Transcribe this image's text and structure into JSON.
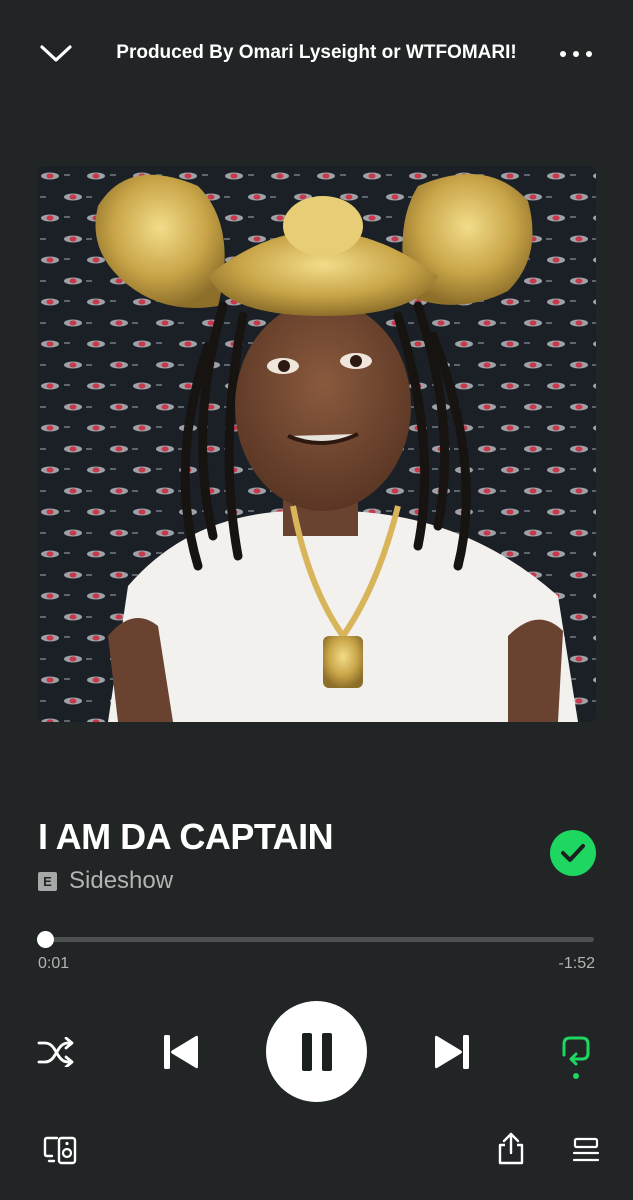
{
  "header": {
    "collapse_icon": "chevron-down-icon",
    "context_title": "Produced By Omari Lyseight or WTFOMARI!",
    "more_icon": "more-horizontal-icon"
  },
  "track": {
    "title": "I AM DA CAPTAIN",
    "explicit_label": "E",
    "artist": "Sideshow",
    "liked": true
  },
  "progress": {
    "elapsed": "0:01",
    "remaining": "-1:52",
    "fraction": 0.009
  },
  "controls": {
    "shuffle_icon": "shuffle-icon",
    "previous_icon": "skip-previous-icon",
    "playpause_icon": "pause-icon",
    "next_icon": "skip-next-icon",
    "repeat_icon": "repeat-icon",
    "repeat_active": true
  },
  "footer": {
    "devices_icon": "connect-device-icon",
    "share_icon": "share-icon",
    "queue_icon": "queue-icon"
  },
  "colors": {
    "background": "#212525",
    "accent": "#1ed760",
    "secondary_text": "#b3b3b3",
    "track_bg": "#4d5151"
  }
}
